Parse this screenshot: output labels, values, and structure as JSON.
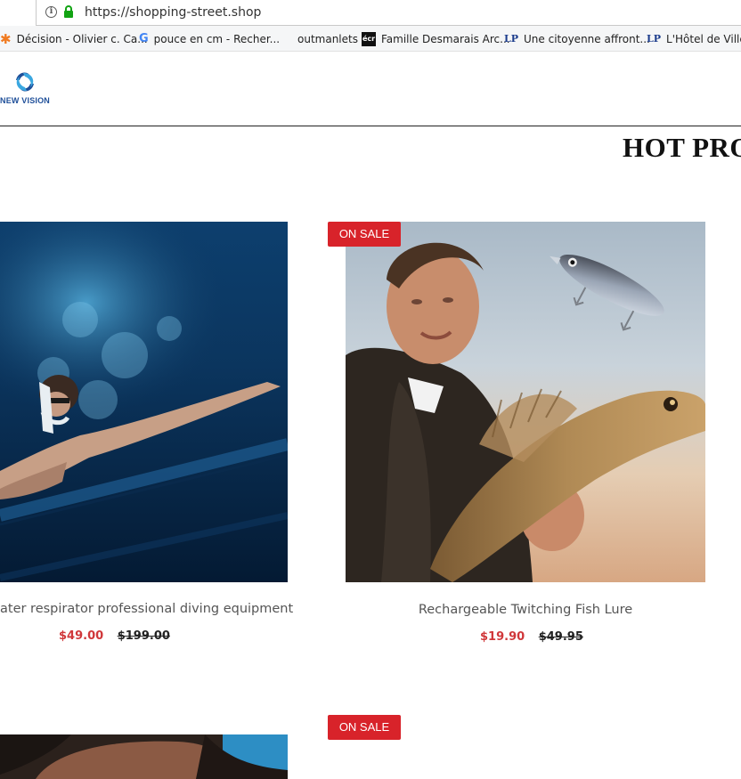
{
  "browser": {
    "url": "https://shopping-street.shop",
    "bookmarks": [
      {
        "label": "Décision - Olivier c. Ca...",
        "icon": "asterisk-icon"
      },
      {
        "label": "pouce en cm - Recher...",
        "icon": "google-icon"
      },
      {
        "label": "outmanlets",
        "icon": ""
      },
      {
        "label": "Famille Desmarais Arc...",
        "icon": "ecr-icon",
        "icon_text": "écr"
      },
      {
        "label": "Une citoyenne affront...",
        "icon": "lp-icon",
        "icon_text": "LP"
      },
      {
        "label": "L'Hôtel de Ville c...",
        "icon": "lp-icon",
        "icon_text": "LP"
      }
    ]
  },
  "site": {
    "logo_text": "NEW VISION",
    "section_title": "HOT PRO"
  },
  "products": [
    {
      "name": "ater respirator professional diving equipment",
      "price": "$49.00",
      "old_price": "$199.00",
      "badge": ""
    },
    {
      "name": "Rechargeable Twitching Fish Lure",
      "price": "$19.90",
      "old_price": "$49.95",
      "badge": "ON SALE"
    },
    {
      "name": "",
      "price": "",
      "old_price": "",
      "badge": ""
    },
    {
      "name": "",
      "price": "",
      "old_price": "",
      "badge": "ON SALE"
    }
  ],
  "colors": {
    "accent_red": "#d8232a",
    "sale_price": "#d0373a",
    "brand_blue": "#1f4f99"
  }
}
